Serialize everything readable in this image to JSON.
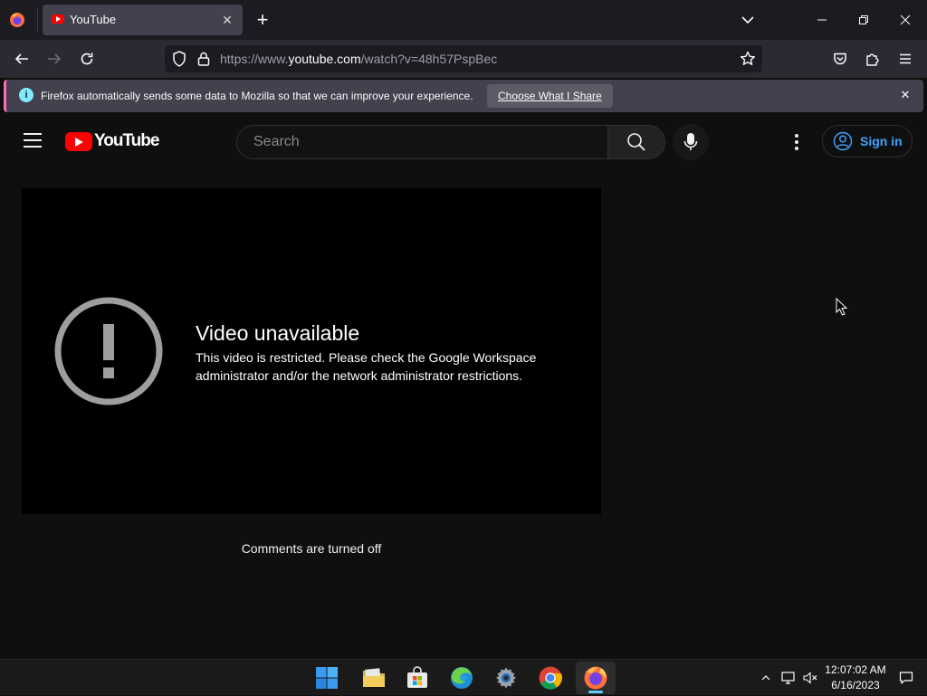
{
  "browser": {
    "tab": {
      "title": "YouTube"
    },
    "url": {
      "prefix": "https://www.",
      "host": "youtube.com",
      "path": "/watch?v=48h57PspBec"
    },
    "notification": {
      "text": "Firefox automatically sends some data to Mozilla so that we can improve your experience.",
      "button": "Choose What I Share"
    }
  },
  "youtube": {
    "logo_text": "YouTube",
    "search_placeholder": "Search",
    "signin_label": "Sign in",
    "error_title": "Video unavailable",
    "error_message": "This video is restricted. Please check the Google Workspace administrator and/or the network administrator restrictions.",
    "comments_status": "Comments are turned off"
  },
  "taskbar": {
    "apps": [
      "start-icon",
      "file-explorer-icon",
      "microsoft-store-icon",
      "edge-icon",
      "settings-icon",
      "chrome-icon",
      "firefox-icon"
    ],
    "time": "12:07:02 AM",
    "date": "6/16/2023"
  },
  "colors": {
    "accent": "#3ea6ff",
    "youtube_red": "#ff0000",
    "page_bg": "#0f0f0f"
  }
}
